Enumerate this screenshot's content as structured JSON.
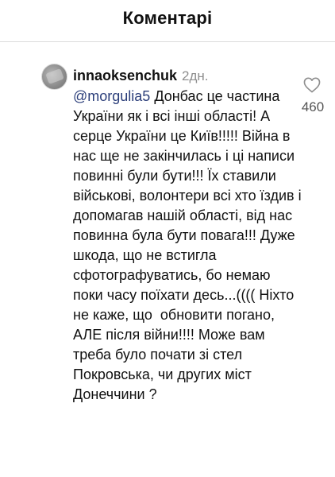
{
  "header": {
    "title": "Коментарі"
  },
  "comment": {
    "username": "innaoksenchuk",
    "timestamp": "2дн.",
    "mention": "@morgulia5",
    "text": " Донбас це частина  України як і всі інші області! А серце України це Київ!!!!! Війна в нас ще не закінчилась і ці написи повинні були бути!!! Їх ставили військові, волонтери всі хто їздив і допомагав нашій області, від нас повинна була бути повага!!! Дуже шкода, що не встигла сфотографуватись, бо немаю поки часу поїхати десь...(((( Ніхто не каже, що  обновити погано, АЛЕ після війни!!!! Може вам треба було почати зі стел Покровська, чи других міст Донеччини ?",
    "like_count": "460",
    "like_icon": "heart-outline-icon"
  }
}
